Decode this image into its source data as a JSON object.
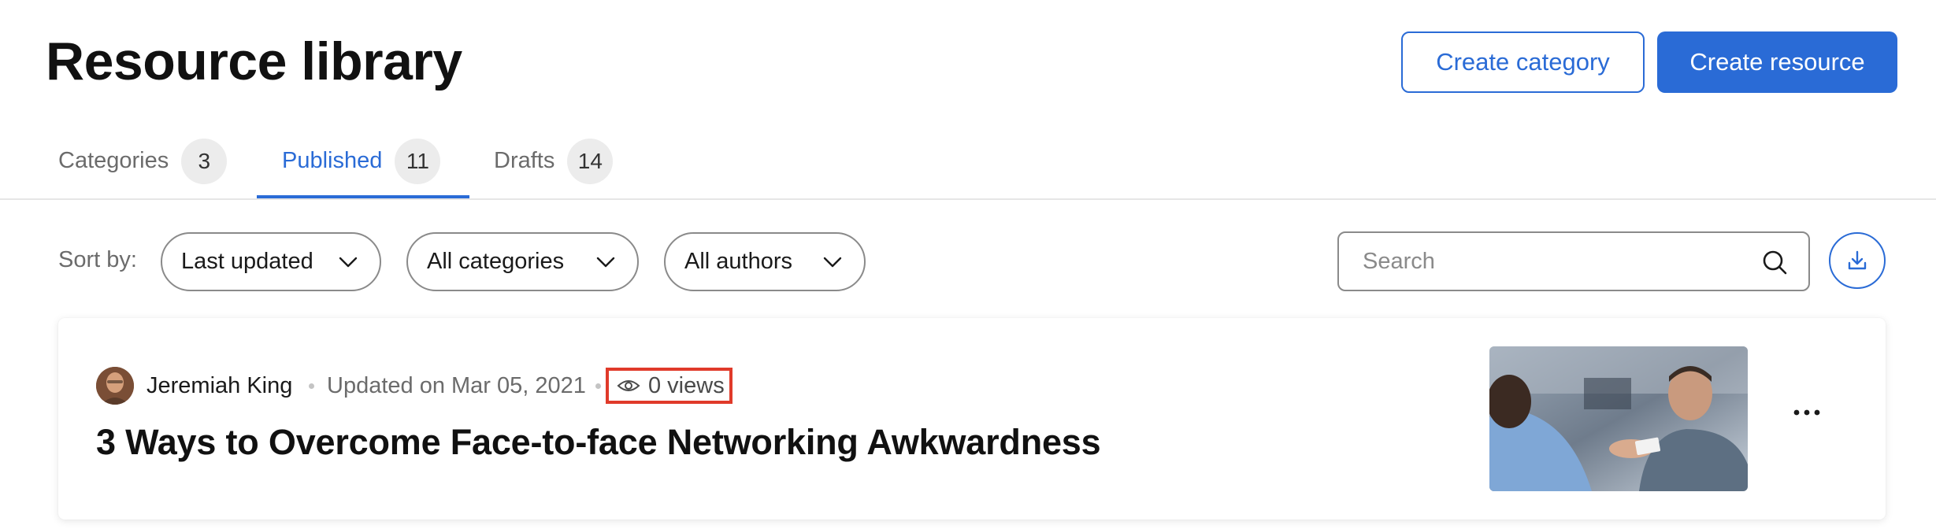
{
  "header": {
    "title": "Resource library",
    "create_category_label": "Create category",
    "create_resource_label": "Create resource"
  },
  "tabs": [
    {
      "label": "Categories",
      "count": "3",
      "active": false
    },
    {
      "label": "Published",
      "count": "11",
      "active": true
    },
    {
      "label": "Drafts",
      "count": "14",
      "active": false
    }
  ],
  "filters": {
    "sort_label": "Sort by:",
    "sort_value": "Last updated",
    "category_value": "All categories",
    "author_value": "All authors",
    "search_placeholder": "Search"
  },
  "icons": {
    "chevron": "chevron-down-icon",
    "search": "search-icon",
    "download": "download-icon",
    "views": "eye-icon",
    "more": "more-horizontal-icon"
  },
  "resource": {
    "author": "Jeremiah King",
    "updated": "Updated on Mar 05, 2021",
    "views": "0 views",
    "title": "3 Ways to Overcome Face-to-face Networking Awkwardness"
  },
  "colors": {
    "accent": "#2a6bd6",
    "highlight": "#e03a2a"
  }
}
